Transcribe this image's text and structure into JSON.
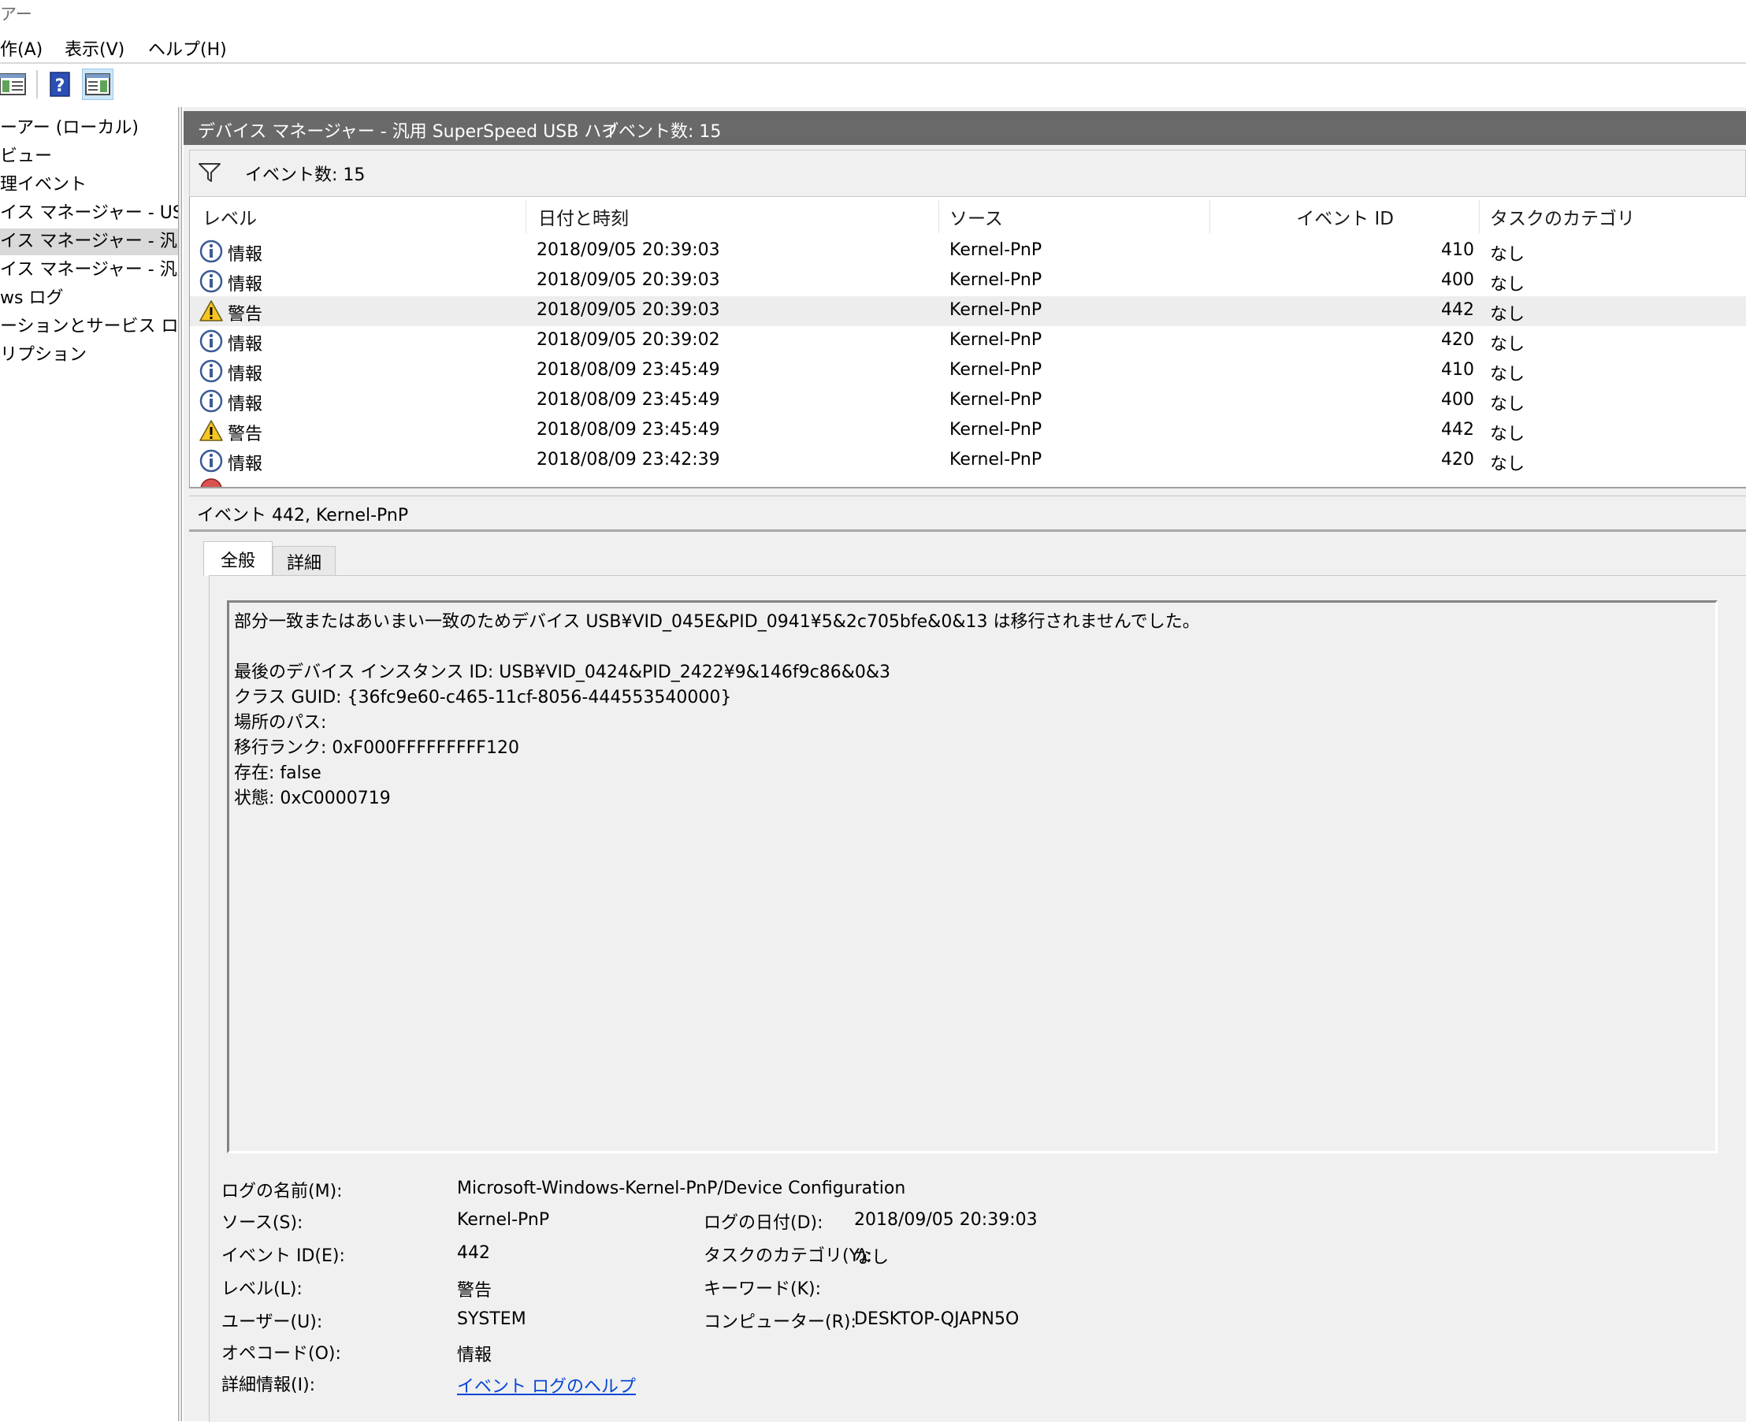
{
  "window": {
    "title": "アー"
  },
  "menu": [
    {
      "label": "作(A)"
    },
    {
      "label": "表示(V)"
    },
    {
      "label": "ヘルプ(H)"
    }
  ],
  "toolbar": {
    "buttons": [
      {
        "icon": "show-hide-tree-icon"
      },
      {
        "icon": "help-icon"
      },
      {
        "icon": "show-hide-action-pane-icon"
      }
    ]
  },
  "tree": {
    "items": [
      {
        "label": "ーアー (ローカル)"
      },
      {
        "label": "ビュー"
      },
      {
        "label": "理イベント"
      },
      {
        "label": "イス マネージャー - USB ル"
      },
      {
        "label": "イス マネージャー - 汎用 S"
      },
      {
        "label": "イス マネージャー - 汎用 U"
      },
      {
        "label": "ws ログ"
      },
      {
        "label": "ーションとサービス ログ"
      },
      {
        "label": "リプション"
      }
    ]
  },
  "pane": {
    "title": "デバイス マネージャー - 汎用 SuperSpeed USB ハブ",
    "count": "イベント数: 15"
  },
  "filter": {
    "text": "イベント数: 15"
  },
  "grid": {
    "columns": [
      "レベル",
      "日付と時刻",
      "ソース",
      "イベント ID",
      "タスクのカテゴリ"
    ],
    "rows": [
      {
        "level": "情報",
        "icon": "info-icon",
        "datetime": "2018/09/05 20:39:03",
        "source": "Kernel-PnP",
        "id": "410",
        "category": "なし"
      },
      {
        "level": "情報",
        "icon": "info-icon",
        "datetime": "2018/09/05 20:39:03",
        "source": "Kernel-PnP",
        "id": "400",
        "category": "なし"
      },
      {
        "level": "警告",
        "icon": "warning-icon",
        "datetime": "2018/09/05 20:39:03",
        "source": "Kernel-PnP",
        "id": "442",
        "category": "なし"
      },
      {
        "level": "情報",
        "icon": "info-icon",
        "datetime": "2018/09/05 20:39:02",
        "source": "Kernel-PnP",
        "id": "420",
        "category": "なし"
      },
      {
        "level": "情報",
        "icon": "info-icon",
        "datetime": "2018/08/09 23:45:49",
        "source": "Kernel-PnP",
        "id": "410",
        "category": "なし"
      },
      {
        "level": "情報",
        "icon": "info-icon",
        "datetime": "2018/08/09 23:45:49",
        "source": "Kernel-PnP",
        "id": "400",
        "category": "なし"
      },
      {
        "level": "警告",
        "icon": "warning-icon",
        "datetime": "2018/08/09 23:45:49",
        "source": "Kernel-PnP",
        "id": "442",
        "category": "なし"
      },
      {
        "level": "情報",
        "icon": "info-icon",
        "datetime": "2018/08/09 23:42:39",
        "source": "Kernel-PnP",
        "id": "420",
        "category": "なし"
      }
    ]
  },
  "detail": {
    "title": "イベント 442, Kernel-PnP",
    "tabs": [
      "全般",
      "詳細"
    ],
    "message": [
      "部分一致またはあいまい一致のためデバイス USB¥VID_045E&PID_0941¥5&2c705bfe&0&13 は移行されませんでした。",
      "",
      "最後のデバイス インスタンス ID: USB¥VID_0424&PID_2422¥9&146f9c86&0&3",
      "クラス GUID: {36fc9e60-c465-11cf-8056-444553540000}",
      "場所のパス:",
      "移行ランク: 0xF000FFFFFFFFF120",
      "存在: false",
      "状態: 0xC0000719"
    ],
    "props": {
      "log_name_label": "ログの名前(M):",
      "log_name": "Microsoft-Windows-Kernel-PnP/Device Configuration",
      "source_label": "ソース(S):",
      "source": "Kernel-PnP",
      "logged_label": "ログの日付(D):",
      "logged": "2018/09/05 20:39:03",
      "event_id_label": "イベント ID(E):",
      "event_id": "442",
      "task_label": "タスクのカテゴリ(Y):",
      "task": "なし",
      "level_label": "レベル(L):",
      "level": "警告",
      "keywords_label": "キーワード(K):",
      "user_label": "ユーザー(U):",
      "user": "SYSTEM",
      "computer_label": "コンピューター(R):",
      "computer": "DESKTOP-QJAPN5O",
      "opcode_label": "オペコード(O):",
      "opcode": "情報",
      "more_info_label": "詳細情報(I):",
      "more_info_link": "イベント ログのヘルプ"
    }
  }
}
